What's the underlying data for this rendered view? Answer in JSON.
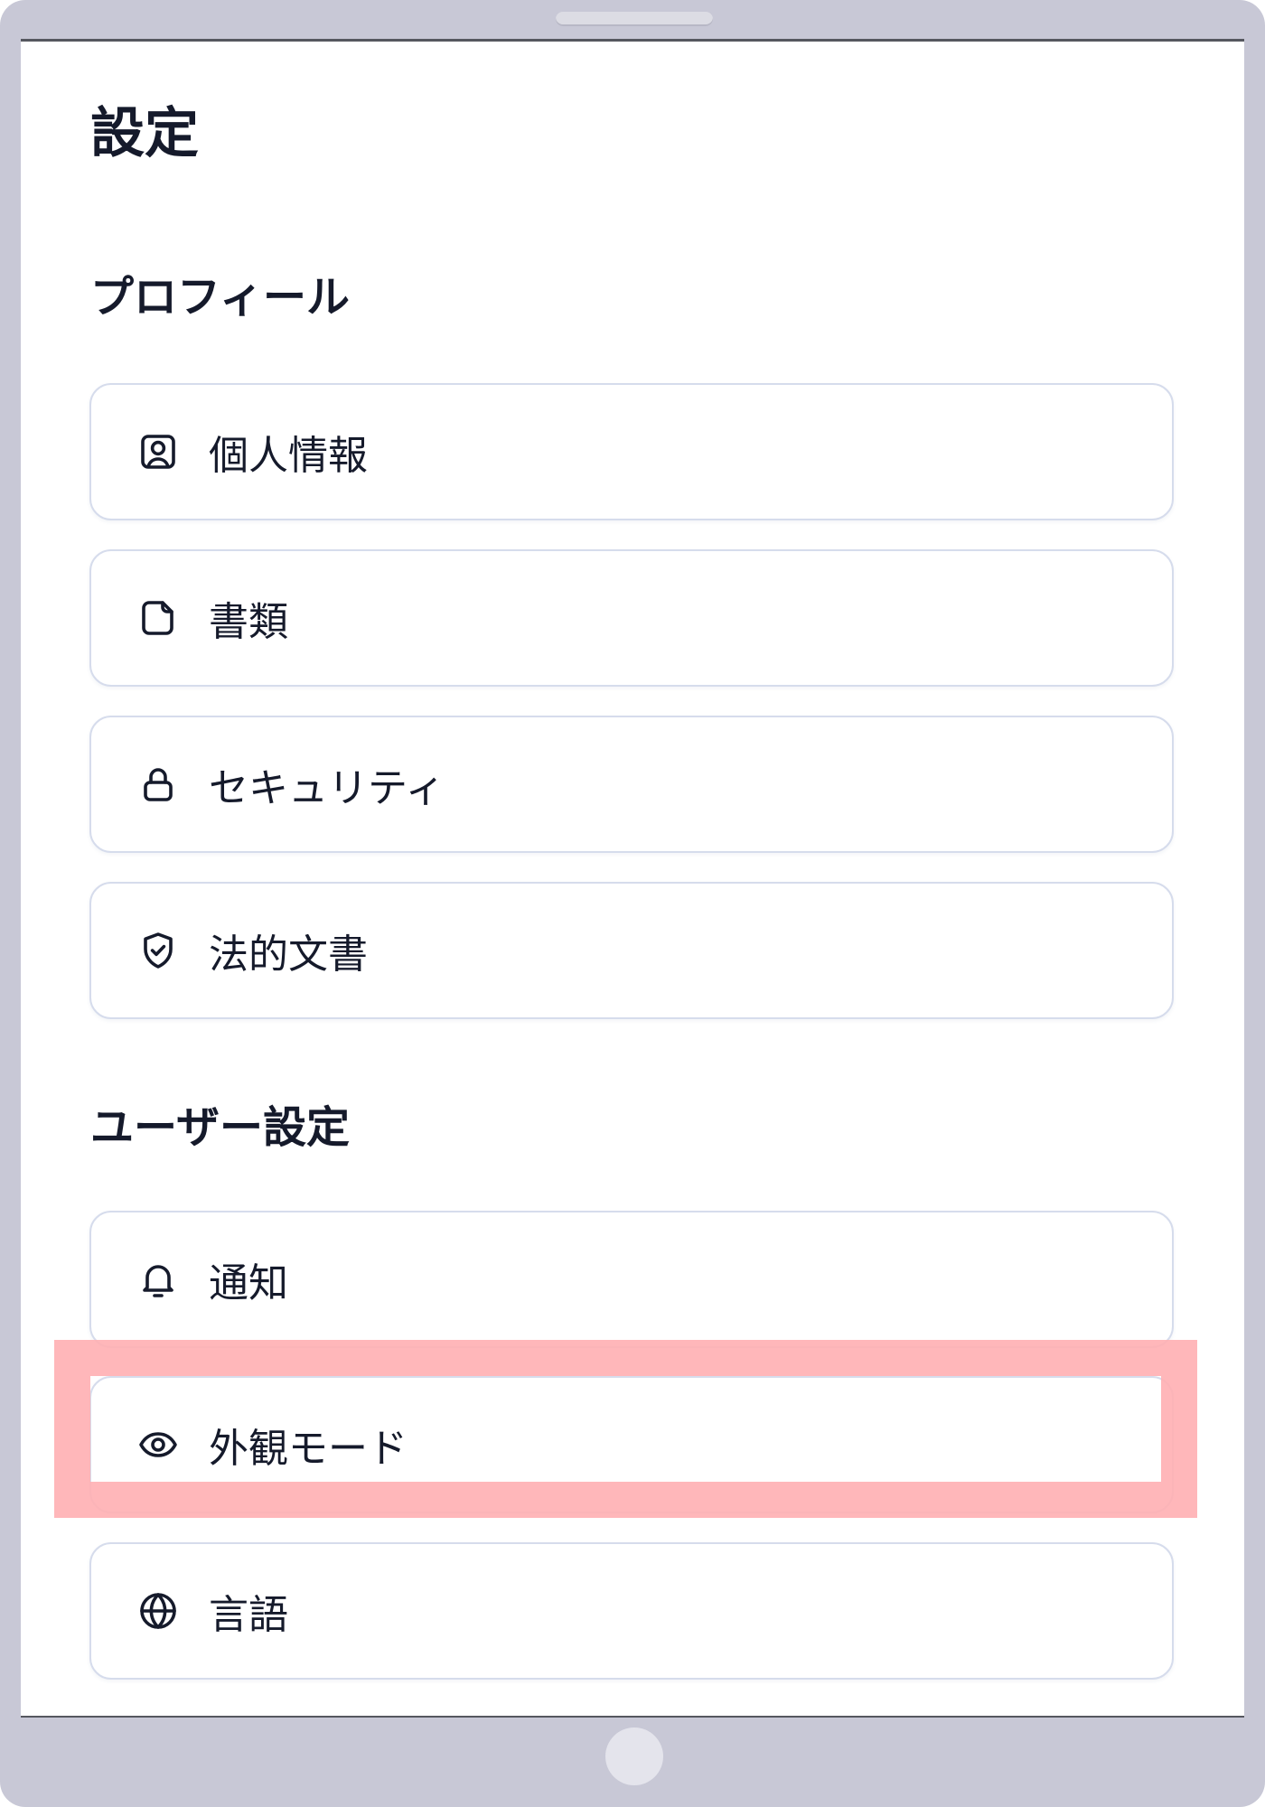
{
  "header": {
    "title": "設定"
  },
  "sections": [
    {
      "title": "プロフィール",
      "items": [
        {
          "label": "個人情報",
          "icon": "user-square-icon"
        },
        {
          "label": "書類",
          "icon": "document-icon"
        },
        {
          "label": "セキュリティ",
          "icon": "lock-icon"
        },
        {
          "label": "法的文書",
          "icon": "shield-check-icon"
        }
      ]
    },
    {
      "title": "ユーザー設定",
      "items": [
        {
          "label": "通知",
          "icon": "bell-icon"
        },
        {
          "label": "外観モード",
          "icon": "eye-icon"
        },
        {
          "label": "言語",
          "icon": "globe-icon"
        }
      ]
    }
  ],
  "highlighted_item": "外観モード",
  "colors": {
    "device_frame": "#c8c8d6",
    "text": "#151a2b",
    "card_border": "#d6dcec",
    "highlight": "#ffafb2"
  }
}
